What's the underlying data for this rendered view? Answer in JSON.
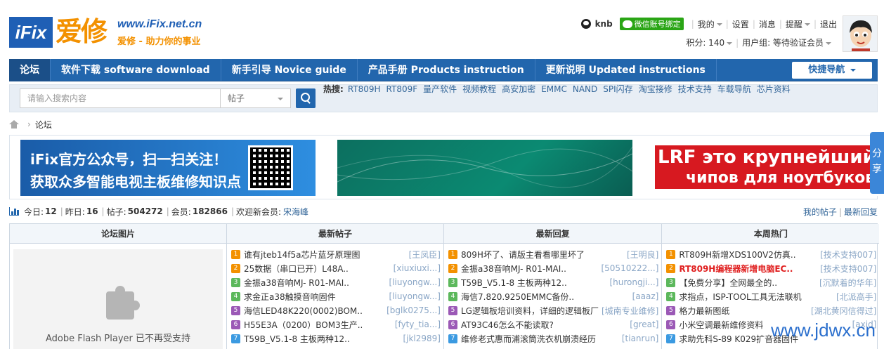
{
  "logo": {
    "box": "iFix",
    "cn": "爱修",
    "url": "www.iFix.net.cn",
    "slogan": "爱修 - 助力你的事业"
  },
  "user": {
    "name": "knb",
    "wechat_bind": "微信账号绑定",
    "links": [
      "我的",
      "设置",
      "消息",
      "提醒",
      "退出"
    ],
    "points_label": "积分: 140",
    "group_label": "用户组: 等待验证会员"
  },
  "nav": {
    "items": [
      "论坛",
      "软件下载 software download",
      "新手引导 Novice guide",
      "产品手册 Products instruction",
      "更新说明 Updated instructions"
    ],
    "quick": "快捷导航"
  },
  "search": {
    "placeholder": "请输入搜索内容",
    "scope": "帖子",
    "hot_label": "热搜:",
    "hot_keywords": [
      "RT809H",
      "RT809F",
      "量产软件",
      "视频教程",
      "高安加密",
      "EMMC",
      "NAND",
      "SPI闪存",
      "淘宝接修",
      "技术支持",
      "车载导航",
      "芯片资料"
    ]
  },
  "breadcrumb": {
    "current": "论坛"
  },
  "banners": {
    "b1_line1": "iFix官方公众号，扫一扫关注！",
    "b1_line2": "获取众多智能电视主板维修知识点",
    "b3_line1": "LRF это крупнейший по",
    "b3_line2": "чипов для ноутбуков"
  },
  "share_tab": "分享",
  "stats": {
    "today_label": "今日:",
    "today": "12",
    "yesterday_label": "昨日:",
    "yesterday": "16",
    "posts_label": "帖子:",
    "posts": "504272",
    "members_label": "会员:",
    "members": "182866",
    "welcome": "欢迎新会员:",
    "new_member": "宋海峰",
    "my_posts": "我的帖子",
    "latest_reply": "最新回复"
  },
  "columns": {
    "pics": "论坛图片",
    "new_posts": "最新帖子",
    "new_replies": "最新回复",
    "week_hot": "本周热门"
  },
  "flash_text": "Adobe Flash Player 已不再受支持",
  "new_posts": [
    {
      "n": "1",
      "title": "谁有jteb14f5a芯片蓝牙原理图",
      "author": "[王凤臣]"
    },
    {
      "n": "2",
      "title": "25数据（串口已开）L48A..",
      "author": "[xiuxiuxi...]"
    },
    {
      "n": "3",
      "title": "金振a38音响MJ- R01-MAI..",
      "author": "[liuyongw...]"
    },
    {
      "n": "4",
      "title": "求金正a38触摸音响固件",
      "author": "[liuyongw...]"
    },
    {
      "n": "5",
      "title": "海信LED48K220(0002)BOM..",
      "author": "[bglk0275...]"
    },
    {
      "n": "6",
      "title": "H55E3A（0200）BOM3生产..",
      "author": "[fyty_tia...]"
    },
    {
      "n": "7",
      "title": "T59B_V5.1-8 主板两种12..",
      "author": "[jkl2989]"
    }
  ],
  "new_replies": [
    {
      "n": "1",
      "title": "809H坏了、请版主看看哪里坏了",
      "author": "[王明良]"
    },
    {
      "n": "2",
      "title": "金振a38音响MJ- R01-MAI..",
      "author": "[50510222...]"
    },
    {
      "n": "3",
      "title": "T59B_V5.1-8 主板两种12..",
      "author": "[hurongji...]"
    },
    {
      "n": "4",
      "title": "海信7.820.9250EMMC备份..",
      "author": "[aaaz]"
    },
    {
      "n": "5",
      "title": "LG逻辑板培训资料，详细的逻辑板厂",
      "author": "[城南专业维修]"
    },
    {
      "n": "6",
      "title": "AT93C46怎么不能读取?",
      "author": "[great]"
    },
    {
      "n": "7",
      "title": "维修老式惠而浦滚筒洗衣机崩溃经历",
      "author": "[tianrun]"
    }
  ],
  "week_hot": [
    {
      "n": "1",
      "title": "RT809H新增XDS100V2仿真..",
      "author": "[技术支持007]",
      "red": false
    },
    {
      "n": "2",
      "title": "RT809H编程器新增电脑EC..",
      "author": "[技术支持007]",
      "red": true
    },
    {
      "n": "3",
      "title": "【免费分享】全网最全的..",
      "author": "[沉默着的华年]",
      "red": false
    },
    {
      "n": "4",
      "title": "求指点，ISP-TOOL工具无法联机",
      "author": "[北派高手]",
      "red": false
    },
    {
      "n": "5",
      "title": "格力最新图纸",
      "author": "[湖北黄冈信得过]",
      "red": false
    },
    {
      "n": "6",
      "title": "小米空调最新维修资料",
      "author": "[axid]",
      "red": false
    },
    {
      "n": "7",
      "title": "求助先科S-89 K029扩音器固件",
      "author": "",
      "red": false
    }
  ],
  "badge_colors": [
    "#f39100",
    "#f39100",
    "#5cb85c",
    "#5cb85c",
    "#9b59b6",
    "#9b59b6",
    "#3b9ae1"
  ],
  "watermark": "www.jdwx.cn"
}
